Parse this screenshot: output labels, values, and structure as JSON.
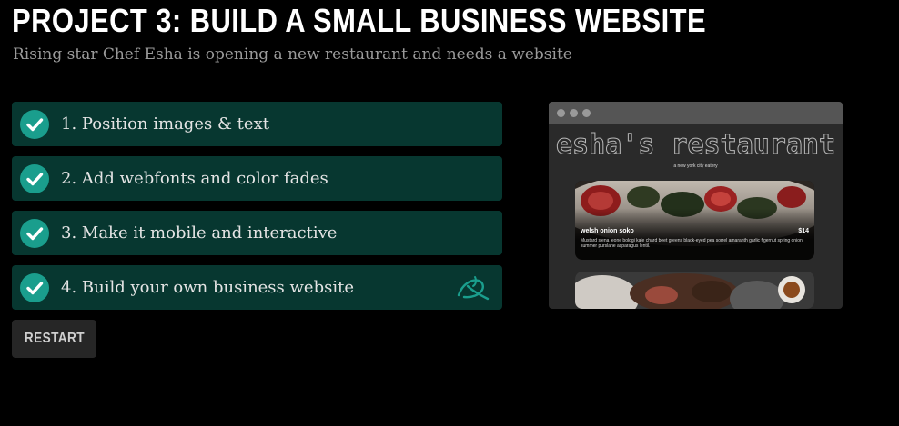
{
  "header": {
    "title": "PROJECT 3: BUILD A SMALL BUSINESS WEBSITE",
    "subtitle": "Rising star Chef Esha is opening a new restaurant and needs a website"
  },
  "steps": [
    {
      "label": "1. Position images & text",
      "status": "complete"
    },
    {
      "label": "2. Add webfonts and color fades",
      "status": "complete"
    },
    {
      "label": "3. Make it mobile and interactive",
      "status": "complete"
    },
    {
      "label": "4. Build your own business website",
      "status": "complete",
      "extra_icon": "leaf-icon"
    }
  ],
  "restart_label": "RESTART",
  "preview": {
    "logo": "esha's restaurant",
    "tagline": "a new york city eatery",
    "dish_name": "welsh onion soko",
    "dish_price": "$14",
    "dish_desc": "Mustard siena leone bologi kale chard beet greens black-eyed pea sorrel amaranth garlic figernut spring onion summer purslane asparagus lentil."
  },
  "colors": {
    "background": "#000000",
    "step_bg": "#073730",
    "check_bg": "#1a9e8d",
    "restart_bg": "#262626"
  }
}
